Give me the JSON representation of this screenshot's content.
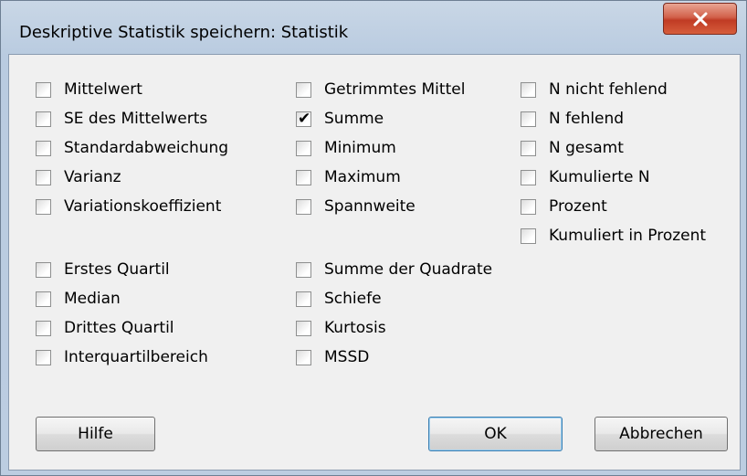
{
  "window": {
    "title": "Deskriptive Statistik speichern: Statistik",
    "close_icon": "close-icon"
  },
  "checkboxes": {
    "col1": [
      {
        "label": "Mittelwert",
        "checked": false
      },
      {
        "label": "SE des Mittelwerts",
        "checked": false
      },
      {
        "label": "Standardabweichung",
        "checked": false
      },
      {
        "label": "Varianz",
        "checked": false
      },
      {
        "label": "Variationskoeffizient",
        "checked": false
      },
      {
        "label": "Erstes Quartil",
        "checked": false
      },
      {
        "label": "Median",
        "checked": false
      },
      {
        "label": "Drittes Quartil",
        "checked": false
      },
      {
        "label": "Interquartilbereich",
        "checked": false
      }
    ],
    "col2": [
      {
        "label": "Getrimmtes Mittel",
        "checked": false
      },
      {
        "label": "Summe",
        "checked": true
      },
      {
        "label": "Minimum",
        "checked": false
      },
      {
        "label": "Maximum",
        "checked": false
      },
      {
        "label": "Spannweite",
        "checked": false
      },
      {
        "label": "Summe der Quadrate",
        "checked": false
      },
      {
        "label": "Schiefe",
        "checked": false
      },
      {
        "label": "Kurtosis",
        "checked": false
      },
      {
        "label": "MSSD",
        "checked": false
      }
    ],
    "col3": [
      {
        "label": "N nicht fehlend",
        "checked": false
      },
      {
        "label": "N fehlend",
        "checked": false
      },
      {
        "label": "N gesamt",
        "checked": false
      },
      {
        "label": "Kumulierte N",
        "checked": false
      },
      {
        "label": "Prozent",
        "checked": false
      },
      {
        "label": "Kumuliert in Prozent",
        "checked": false
      }
    ]
  },
  "buttons": {
    "help": "Hilfe",
    "ok": "OK",
    "cancel": "Abbrechen"
  }
}
